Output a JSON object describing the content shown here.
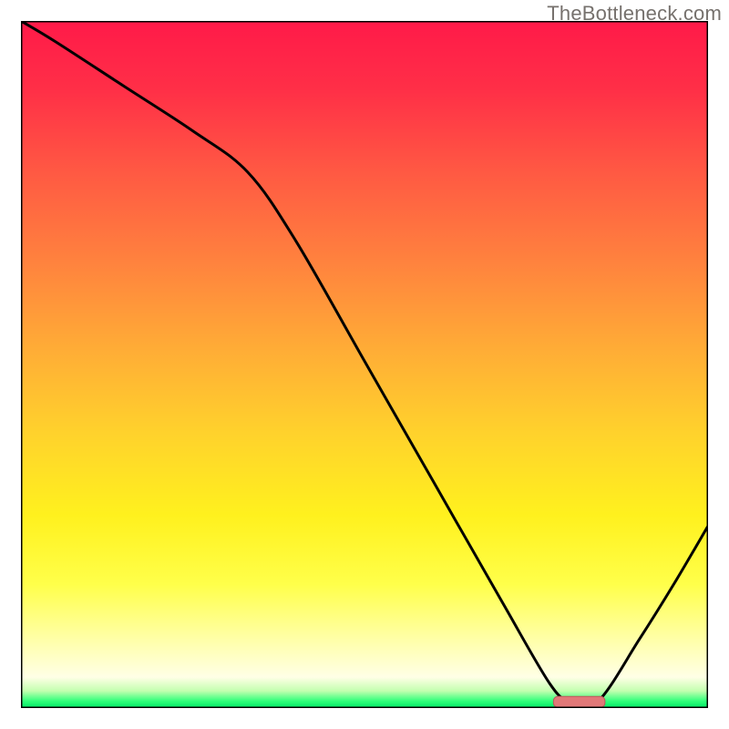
{
  "watermark": "TheBottleneck.com",
  "colors": {
    "gradient_stops": [
      {
        "offset": 0.0,
        "color": "#ff1a49"
      },
      {
        "offset": 0.1,
        "color": "#ff2f47"
      },
      {
        "offset": 0.22,
        "color": "#ff5943"
      },
      {
        "offset": 0.35,
        "color": "#ff823e"
      },
      {
        "offset": 0.48,
        "color": "#ffad36"
      },
      {
        "offset": 0.6,
        "color": "#ffd22c"
      },
      {
        "offset": 0.72,
        "color": "#fff11e"
      },
      {
        "offset": 0.82,
        "color": "#ffff4a"
      },
      {
        "offset": 0.9,
        "color": "#ffffa8"
      },
      {
        "offset": 0.955,
        "color": "#ffffe6"
      },
      {
        "offset": 0.975,
        "color": "#c4ffb0"
      },
      {
        "offset": 0.99,
        "color": "#2fff7a"
      },
      {
        "offset": 1.0,
        "color": "#00e765"
      }
    ],
    "curve": "#000000",
    "marker_fill": "#e17878",
    "marker_stroke": "#b85a5a",
    "frame": "#000000"
  },
  "chart_data": {
    "type": "line",
    "title": "",
    "xlabel": "",
    "ylabel": "",
    "xlim": [
      0,
      100
    ],
    "ylim": [
      0,
      100
    ],
    "grid": false,
    "legend": false,
    "note": "No numeric axis labels or ticks are rendered; x and y are normalized 0–100 left→right and bottom→top. Values estimated from geometry.",
    "series": [
      {
        "name": "curve",
        "x": [
          0.0,
          5.0,
          15.0,
          25.0,
          33.0,
          40.0,
          50.0,
          60.0,
          70.0,
          77.0,
          80.0,
          84.0,
          90.0,
          95.0,
          100.0
        ],
        "y": [
          100.0,
          97.0,
          90.5,
          84.0,
          78.0,
          68.0,
          50.5,
          33.0,
          15.5,
          3.5,
          1.0,
          1.0,
          10.0,
          18.0,
          26.5
        ]
      }
    ],
    "marker": {
      "shape": "rounded-bar",
      "x_range": [
        77.5,
        85.0
      ],
      "y": 0.9,
      "purpose": "highlight of minimum / recommended zone"
    }
  }
}
